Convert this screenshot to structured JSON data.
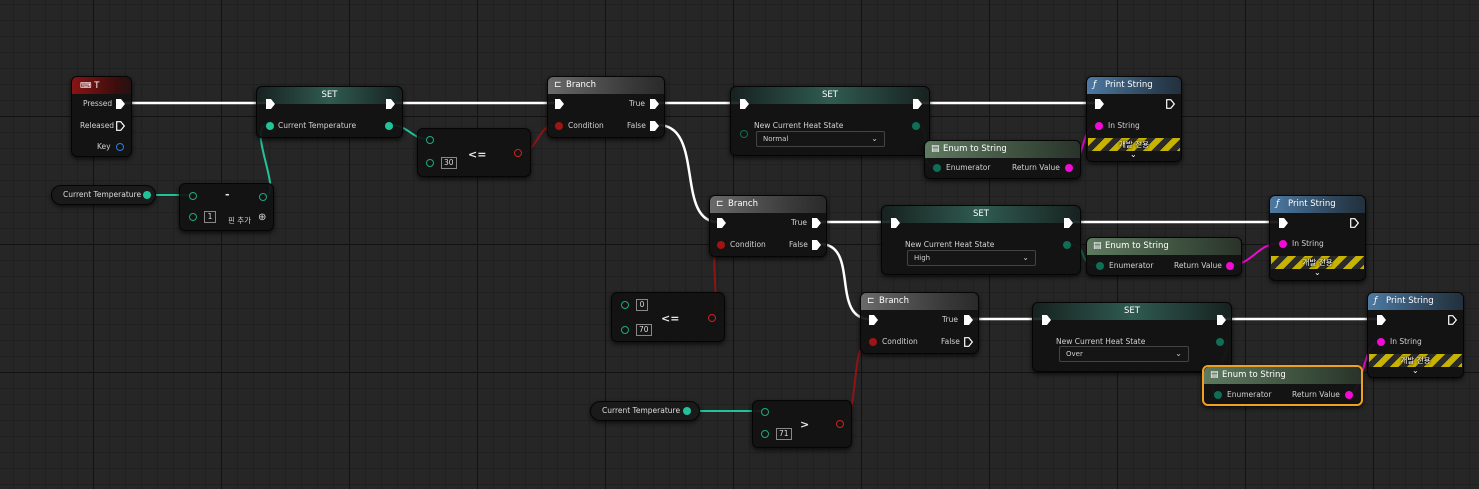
{
  "nodes": {
    "key_t": {
      "title": "T",
      "pressed": "Pressed",
      "released": "Released",
      "key": "Key"
    },
    "set1": {
      "title": "SET",
      "var": "Current Temperature"
    },
    "sub": {
      "op": "-",
      "b": "1",
      "add_pin": "핀 추가"
    },
    "get_temp1": {
      "label": "Current Temperature"
    },
    "le30": {
      "op": "<=",
      "b": "30"
    },
    "branch1": {
      "title": "Branch",
      "condition": "Condition",
      "true": "True",
      "false": "False"
    },
    "set_normal": {
      "title": "SET",
      "var": "New Current Heat State",
      "value": "Normal"
    },
    "enum1": {
      "title": "Enum to String",
      "in": "Enumerator",
      "out": "Return Value"
    },
    "print1": {
      "title": "Print String",
      "in": "In String",
      "dev": "개발 전용"
    },
    "branch2": {
      "title": "Branch",
      "condition": "Condition",
      "true": "True",
      "false": "False"
    },
    "set_high": {
      "title": "SET",
      "var": "New Current Heat State",
      "value": "High"
    },
    "enum2": {
      "title": "Enum to String",
      "in": "Enumerator",
      "out": "Return Value"
    },
    "print2": {
      "title": "Print String",
      "in": "In String",
      "dev": "개발 전용"
    },
    "le70": {
      "op": "<=",
      "a": "0",
      "b": "70"
    },
    "branch3": {
      "title": "Branch",
      "condition": "Condition",
      "true": "True",
      "false": "False"
    },
    "set_over": {
      "title": "SET",
      "var": "New Current Heat State",
      "value": "Over"
    },
    "enum3": {
      "title": "Enum to String",
      "in": "Enumerator",
      "out": "Return Value"
    },
    "print3": {
      "title": "Print String",
      "in": "In String",
      "dev": "개발 전용"
    },
    "get_temp2": {
      "label": "Current Temperature"
    },
    "gt71": {
      "op": ">",
      "b": "71"
    }
  },
  "icons": {
    "keyboard": "keyboard-icon",
    "branch": "branch-icon",
    "function": "function-icon",
    "enum": "enum-icon"
  },
  "colors": {
    "exec": "#ffffff",
    "float_pin": "#21c49a",
    "bool_pin": "#a01414",
    "string_pin": "#f20ad5",
    "enum_pin": "#0f6e56",
    "selected": "#f0a020"
  }
}
